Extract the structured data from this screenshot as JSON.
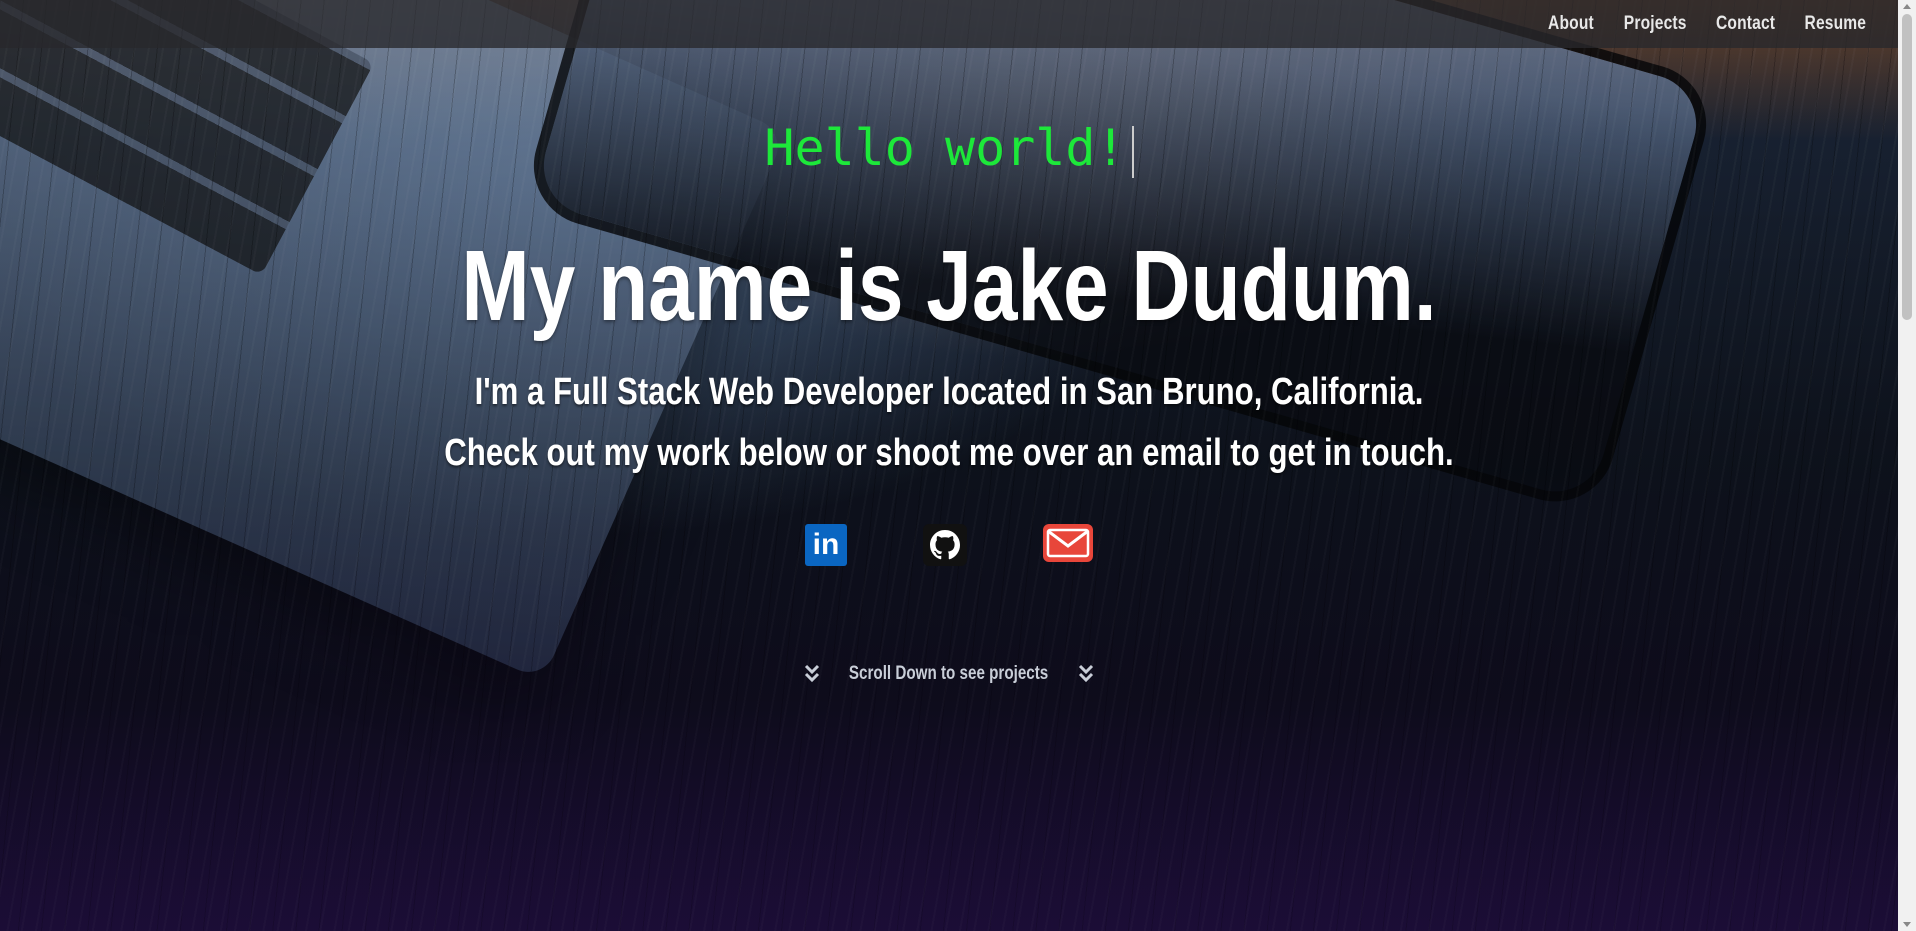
{
  "nav": {
    "items": [
      {
        "label": "About"
      },
      {
        "label": "Projects"
      },
      {
        "label": "Contact"
      },
      {
        "label": "Resume"
      }
    ]
  },
  "hero": {
    "typed_text": "Hello world!",
    "headline": "My name is Jake Dudum.",
    "subline_1": "I'm a Full Stack Web Developer located in San Bruno, California.",
    "subline_2": "Check out my work below or shoot me over an email to get in touch.",
    "socials": [
      {
        "icon": "linkedin-icon",
        "label": "in",
        "color": "#0a66c2"
      },
      {
        "icon": "github-icon",
        "color": "#111111"
      },
      {
        "icon": "email-icon",
        "color": "#e8463a"
      }
    ],
    "scroll_hint": "Scroll Down to see projects"
  },
  "colors": {
    "typed_text": "#1de83a",
    "navbar_bg": "rgba(40,40,44,0.78)"
  }
}
